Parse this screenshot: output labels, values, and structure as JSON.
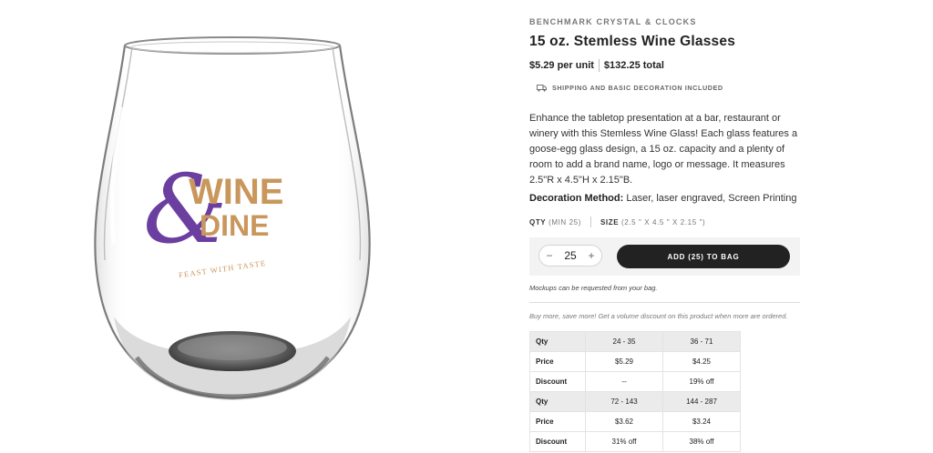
{
  "product": {
    "brand": "BENCHMARK CRYSTAL & CLOCKS",
    "title": "15 oz. Stemless Wine Glasses",
    "price_per_unit": "$5.29 per unit",
    "price_total": "$132.25 total",
    "shipping_note": "SHIPPING AND BASIC DECORATION INCLUDED",
    "description": "Enhance the tabletop presentation at a bar, restaurant or winery with this Stemless Wine Glass! Each glass features a goose-egg glass design, a 15 oz. capacity and a plenty of room to add a brand name, logo or message. It measures 2.5\"R x 4.5\"H x 2.15\"B.",
    "decoration_label": "Decoration Method:",
    "decoration_value": "Laser, laser engraved, Screen Printing"
  },
  "image": {
    "logo_line1": "WINE",
    "logo_line2": "DINE",
    "logo_ampersand": "&",
    "logo_tagline": "FEAST WITH TASTE",
    "colors": {
      "purple": "#6b3fa0",
      "gold": "#c9975c"
    }
  },
  "specs": {
    "qty_label": "QTY",
    "qty_min": "(MIN 25)",
    "size_label": "SIZE",
    "size_value": "(2.5 \" X 4.5 \" X 2.15 \")"
  },
  "cart": {
    "minus": "−",
    "plus": "+",
    "quantity": "25",
    "add_button": "ADD (25) TO BAG",
    "mockups_note": "Mockups can be requested from your bag."
  },
  "volume_note": "Buy more, save more! Get a volume discount on this product when more are ordered.",
  "pricing_table": [
    {
      "label": "Qty",
      "values": [
        "24 - 35",
        "36 - 71"
      ]
    },
    {
      "label": "Price",
      "values": [
        "$5.29",
        "$4.25"
      ]
    },
    {
      "label": "Discount",
      "values": [
        "--",
        "19% off"
      ]
    },
    {
      "label": "Qty",
      "values": [
        "72 - 143",
        "144 - 287"
      ]
    },
    {
      "label": "Price",
      "values": [
        "$3.62",
        "$3.24"
      ]
    },
    {
      "label": "Discount",
      "values": [
        "31% off",
        "38% off"
      ]
    }
  ]
}
